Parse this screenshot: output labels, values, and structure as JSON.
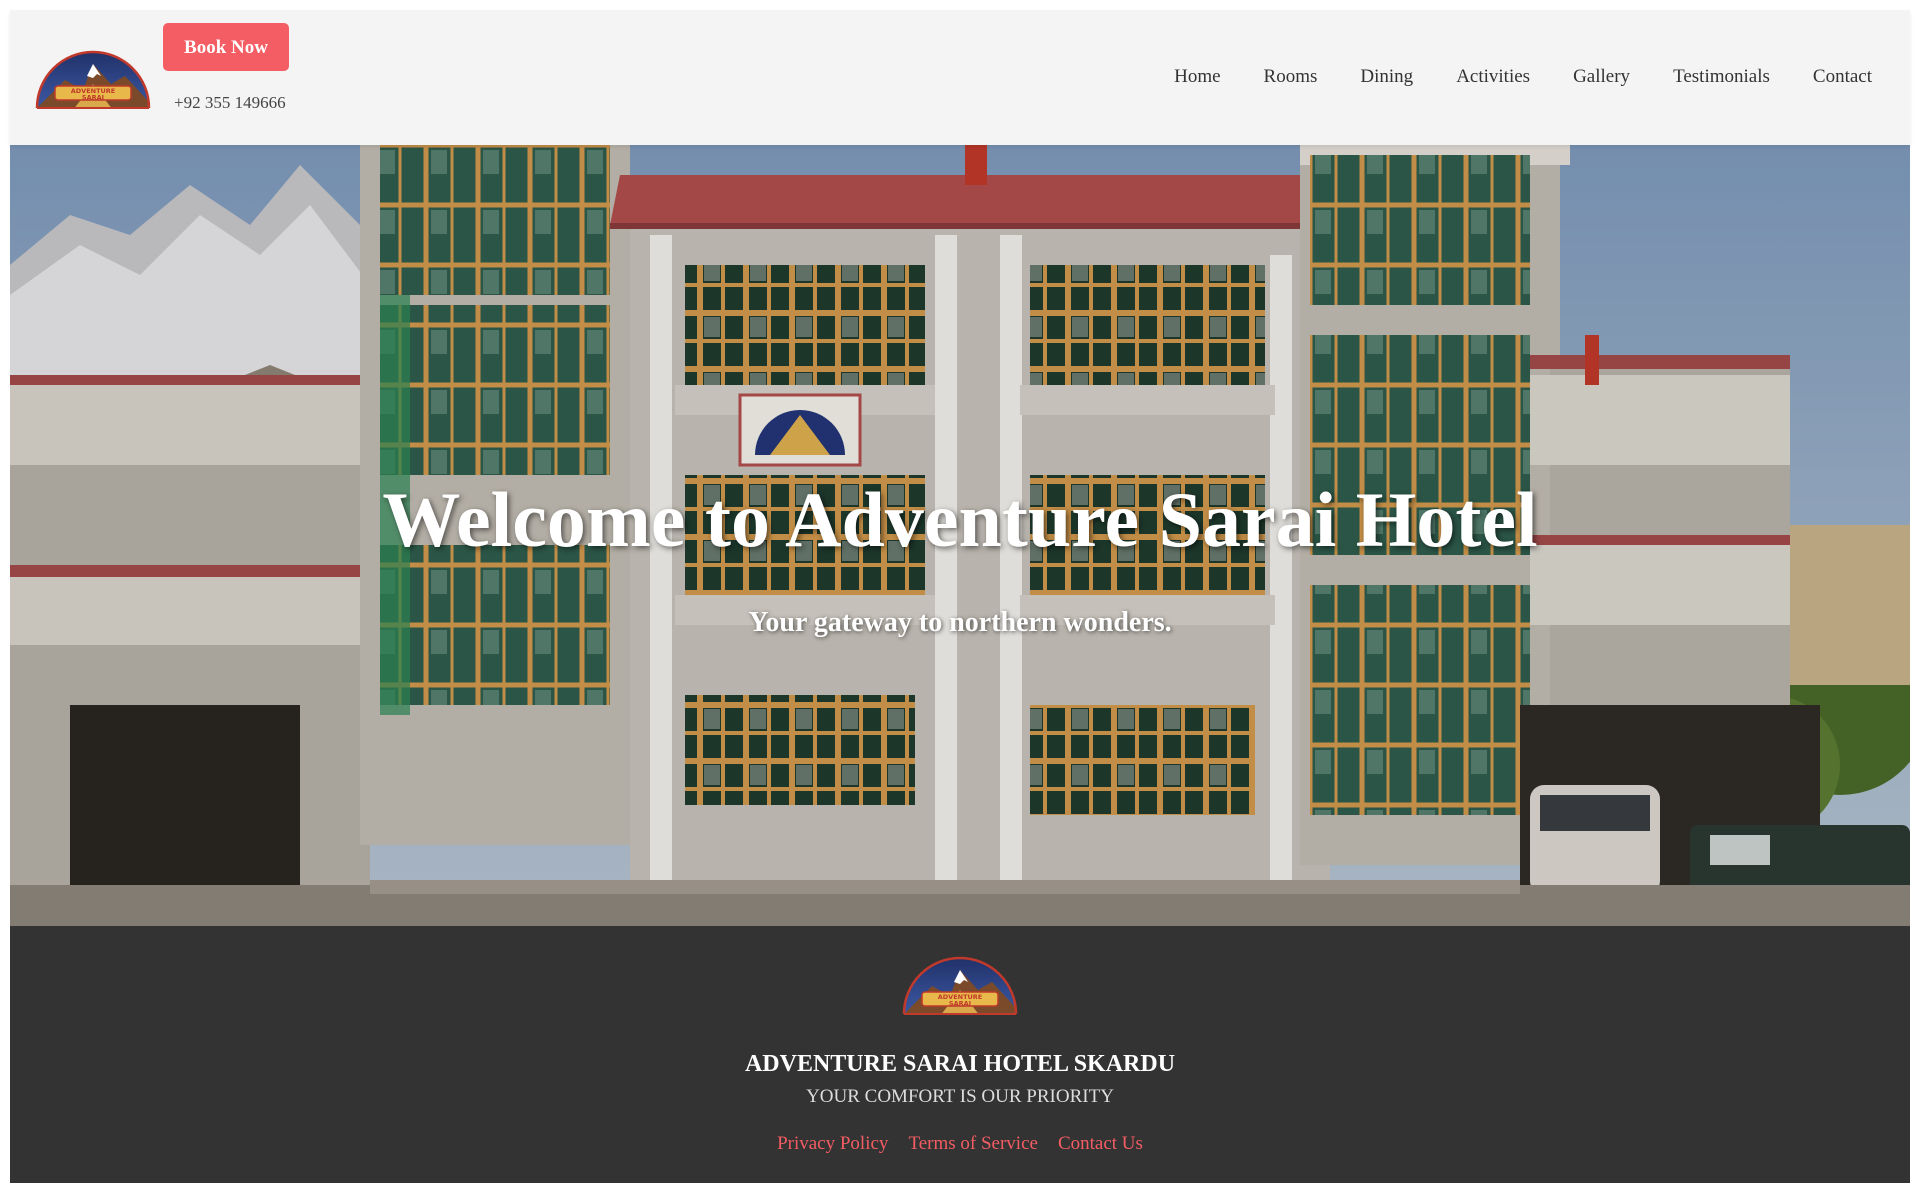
{
  "header": {
    "book_button_label": "Book Now",
    "phone": "+92 355 149666",
    "nav": [
      {
        "label": "Home"
      },
      {
        "label": "Rooms"
      },
      {
        "label": "Dining"
      },
      {
        "label": "Activities"
      },
      {
        "label": "Gallery"
      },
      {
        "label": "Testimonials"
      },
      {
        "label": "Contact"
      }
    ],
    "logo_text": [
      "ADVENTURE",
      "SARAI"
    ]
  },
  "hero": {
    "title": "Welcome to Adventure Sarai Hotel",
    "subtitle": "Your gateway to northern wonders."
  },
  "footer": {
    "title": "ADVENTURE SARAI HOTEL SKARDU",
    "tagline": "YOUR COMFORT IS OUR PRIORITY",
    "links": [
      {
        "label": "Privacy Policy"
      },
      {
        "label": "Terms of Service"
      },
      {
        "label": "Contact Us"
      }
    ]
  },
  "colors": {
    "accent": "#f45d63",
    "header_bg": "#f4f4f4",
    "footer_bg": "#333333"
  }
}
